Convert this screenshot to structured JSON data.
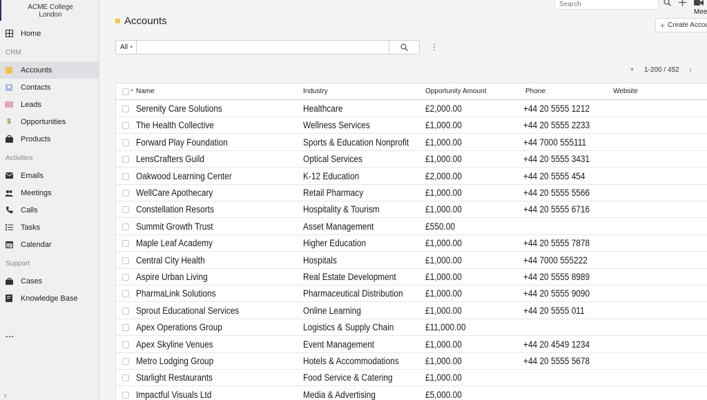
{
  "brand": {
    "line1": "ACME College",
    "line2": "London"
  },
  "sidebar": {
    "home": "Home",
    "crm_label": "CRM",
    "crm_items": [
      "Accounts",
      "Contacts",
      "Leads",
      "Opportunities",
      "Products"
    ],
    "activities_label": "Activities",
    "activities_items": [
      "Emails",
      "Meetings",
      "Calls",
      "Tasks",
      "Calendar"
    ],
    "support_label": "Support",
    "support_items": [
      "Cases",
      "Knowledge Base"
    ],
    "more": "..."
  },
  "header": {
    "search_placeholder": "Search",
    "meet_label": "Mee",
    "create_label": "Create Accou"
  },
  "page": {
    "title": "Accounts"
  },
  "filter": {
    "selected": "All"
  },
  "pager": {
    "range": "1-200 / 452"
  },
  "table": {
    "columns": [
      "Name",
      "Industry",
      "Opportunity Amount",
      "Phone",
      "Website"
    ],
    "rows": [
      {
        "name": "Serenity Care Solutions",
        "industry": "Healthcare",
        "amount": "£2,000.00",
        "phone": "+44 20 5555 1212"
      },
      {
        "name": "The Health Collective",
        "industry": "Wellness Services",
        "amount": "£1,000.00",
        "phone": "+44 20 5555 2233"
      },
      {
        "name": "Forward Play Foundation",
        "industry": "Sports & Education Nonprofit",
        "amount": "£1,000.00",
        "phone": "+44 7000 555111"
      },
      {
        "name": "LensCrafters Guild",
        "industry": "Optical Services",
        "amount": "£1,000.00",
        "phone": "+44 20 5555 3431"
      },
      {
        "name": "Oakwood Learning Center",
        "industry": "K-12 Education",
        "amount": "£2,000.00",
        "phone": "+44 20 5555 454"
      },
      {
        "name": "WellCare Apothecary",
        "industry": "Retail Pharmacy",
        "amount": "£1,000.00",
        "phone": "+44 20 5555 5566"
      },
      {
        "name": "Constellation Resorts",
        "industry": "Hospitality & Tourism",
        "amount": "£1,000.00",
        "phone": "+44 20 5555 6716"
      },
      {
        "name": "Summit Growth Trust",
        "industry": "Asset Management",
        "amount": "£550.00",
        "phone": ""
      },
      {
        "name": "Maple Leaf Academy",
        "industry": "Higher Education",
        "amount": "£1,000.00",
        "phone": "+44 20 5555 7878"
      },
      {
        "name": "Central City Health",
        "industry": "Hospitals",
        "amount": "£1,000.00",
        "phone": "+44 7000 555222"
      },
      {
        "name": "Aspire Urban Living",
        "industry": "Real Estate Development",
        "amount": "£1,000.00",
        "phone": "+44 20 5555 8989"
      },
      {
        "name": "PharmaLink Solutions",
        "industry": "Pharmaceutical Distribution",
        "amount": "£1,000.00",
        "phone": "+44 20 5555 9090"
      },
      {
        "name": "Sprout Educational Services",
        "industry": "Online Learning",
        "amount": "£1,000.00",
        "phone": "+44 20 5555 011"
      },
      {
        "name": "Apex Operations Group",
        "industry": "Logistics & Supply Chain",
        "amount": "£11,000.00",
        "phone": ""
      },
      {
        "name": "Apex Skyline Venues",
        "industry": "Event Management",
        "amount": "£1,000.00",
        "phone": "+44 20 4549 1234"
      },
      {
        "name": "Metro Lodging Group",
        "industry": "Hotels & Accommodations",
        "amount": "£1,000.00",
        "phone": "+44 20 5555 5678"
      },
      {
        "name": "Starlight Restaurants",
        "industry": "Food Service & Catering",
        "amount": "£1,000.00",
        "phone": ""
      },
      {
        "name": "Impactful Visuals Ltd",
        "industry": "Media & Advertising",
        "amount": "£5,000.00",
        "phone": ""
      }
    ]
  }
}
